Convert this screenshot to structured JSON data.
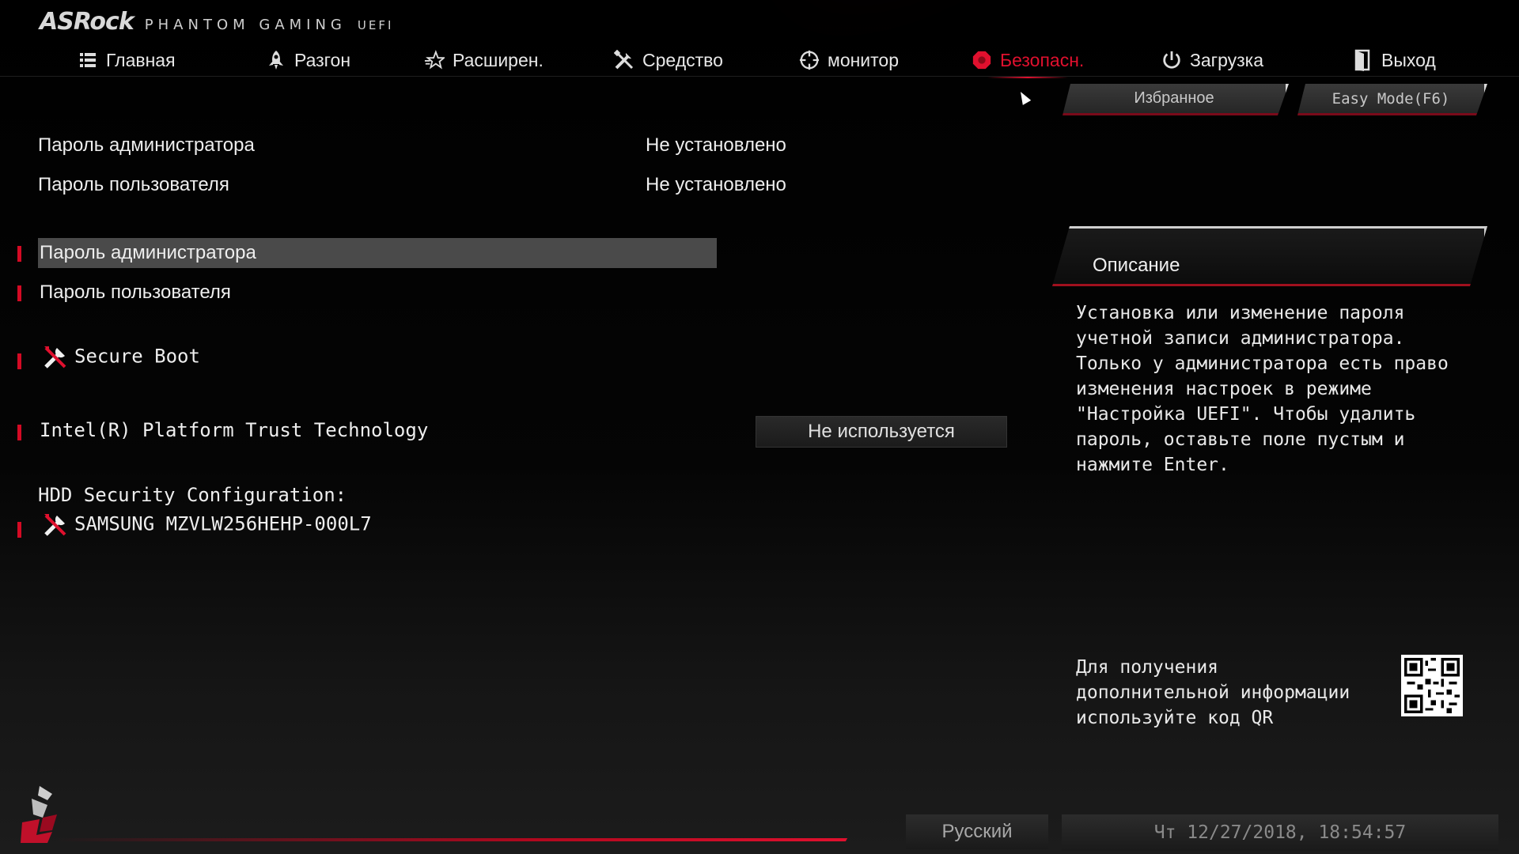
{
  "header": {
    "brand": "ASRock",
    "product": "PHANTOM GAMING",
    "uefi": "UEFI"
  },
  "nav": [
    {
      "label": "Главная",
      "icon": "list-icon",
      "active": false
    },
    {
      "label": "Разгон",
      "icon": "rocket-icon",
      "active": false
    },
    {
      "label": "Расширен.",
      "icon": "star-icon",
      "active": false
    },
    {
      "label": "Средство",
      "icon": "tools-icon",
      "active": false
    },
    {
      "label": "монитор",
      "icon": "crosshair-icon",
      "active": false
    },
    {
      "label": "Безопасн.",
      "icon": "shield-icon",
      "active": true
    },
    {
      "label": "Загрузка",
      "icon": "power-icon",
      "active": false
    },
    {
      "label": "Выход",
      "icon": "exit-door-icon",
      "active": false
    }
  ],
  "top_buttons": {
    "favorites": "Избранное",
    "easy_mode": "Easy Mode(F6)"
  },
  "status": {
    "admin_password_label": "Пароль администратора",
    "admin_password_value": "Не установлено",
    "user_password_label": "Пароль пользователя",
    "user_password_value": "Не установлено"
  },
  "menu": {
    "admin_password": "Пароль администратора",
    "user_password": "Пароль пользователя",
    "secure_boot": "Secure Boot",
    "intel_ptt": "Intel(R) Platform Trust Technology",
    "intel_ptt_value": "Не используется",
    "hdd_section": "HDD Security Configuration:",
    "hdd_device": "SAMSUNG MZVLW256HEHP-000L7"
  },
  "description": {
    "title": "Описание",
    "text": "Установка или изменение пароля\nучетной записи администратора.\nТолько у администратора есть право\nизменения настроек в режиме\n\"Настройка UEFI\". Чтобы удалить\nпароль, оставьте поле пустым и\nнажмите Enter."
  },
  "qr": {
    "text": "Для получения\nдополнительной информации\nиспользуйте код QR"
  },
  "footer": {
    "language": "Русский",
    "datetime": "Чт 12/27/2018, 18:54:57"
  },
  "colors": {
    "accent": "#e0102e",
    "selected_row": "#4a4a4a"
  }
}
